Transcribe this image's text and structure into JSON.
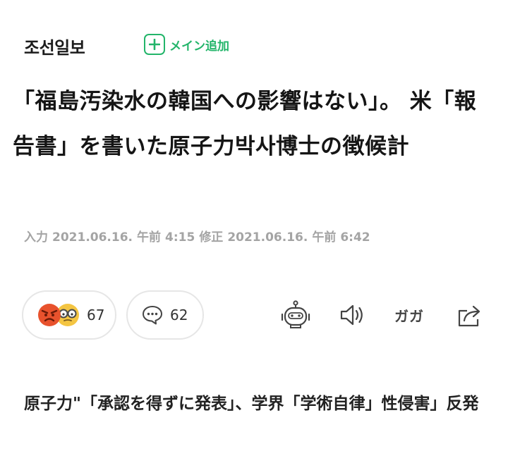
{
  "header": {
    "brand": "조선일보",
    "add_main_label": "メイン追加"
  },
  "article": {
    "headline": "「福島汚染水の韓国への影響はない」。 米「報告書」を書いた原子力박사博士の徴候計",
    "input_label": "入力",
    "input_date": "2021.06.16.",
    "input_ampm": "午前",
    "input_time": "4:15",
    "modified_label": "修正",
    "modified_date": "2021.06.16.",
    "modified_ampm": "午前",
    "modified_time": "6:42"
  },
  "actions": {
    "reaction_count": "67",
    "comment_count": "62",
    "font_size_label": "ガガ",
    "icons": [
      "angry-face-icon",
      "glasses-face-icon",
      "speech-bubble-icon",
      "robot-icon",
      "speaker-icon",
      "share-icon"
    ]
  },
  "related": {
    "text": "原子力\"「承認を得ずに発表」、学界「学術自律」性侵害」反発"
  },
  "colors": {
    "accent_green": "#23b56a",
    "date_gray": "#a4a4a4",
    "pill_border": "#e6e6e6",
    "angry_red": "#e8522d",
    "glasses_yellow": "#f4c542"
  }
}
